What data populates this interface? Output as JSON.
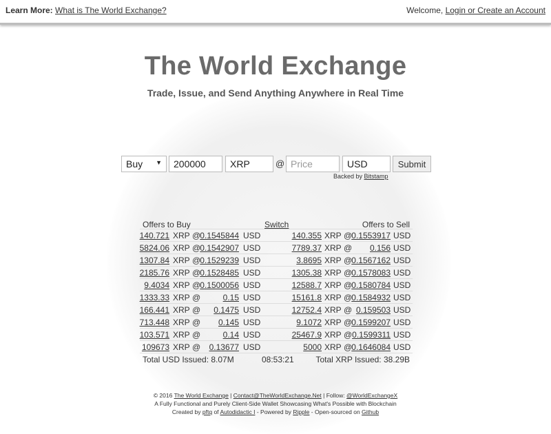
{
  "topbar": {
    "learn_label": "Learn More:",
    "learn_link": "What is The World Exchange?",
    "welcome": "Welcome,",
    "login_link": "Login or Create an Account"
  },
  "hero": {
    "title": "The World Exchange",
    "tagline": "Trade, Issue, and Send Anything Anywhere in Real Time"
  },
  "form": {
    "side": "Buy",
    "amount": "200000",
    "currency1": "XRP",
    "at": "@",
    "price_placeholder": "Price",
    "currency2": "USD",
    "submit": "Submit",
    "backed_by_label": "Backed by",
    "backed_by_link": "Bitstamp"
  },
  "book": {
    "buy_header": "Offers to Buy",
    "switch": "Switch",
    "sell_header": "Offers to Sell",
    "buy": [
      {
        "amount": "140.721",
        "cur": "XRP",
        "at": "@",
        "price": "0.1545844",
        "unit": "USD"
      },
      {
        "amount": "5824.06",
        "cur": "XRP",
        "at": "@",
        "price": "0.1542907",
        "unit": "USD"
      },
      {
        "amount": "1307.84",
        "cur": "XRP",
        "at": "@",
        "price": "0.1529239",
        "unit": "USD"
      },
      {
        "amount": "2185.76",
        "cur": "XRP",
        "at": "@",
        "price": "0.1528485",
        "unit": "USD"
      },
      {
        "amount": "9.4034",
        "cur": "XRP",
        "at": "@",
        "price": "0.1500056",
        "unit": "USD"
      },
      {
        "amount": "1333.33",
        "cur": "XRP",
        "at": "@",
        "price": "0.15",
        "unit": "USD"
      },
      {
        "amount": "166.441",
        "cur": "XRP",
        "at": "@",
        "price": "0.1475",
        "unit": "USD"
      },
      {
        "amount": "713.448",
        "cur": "XRP",
        "at": "@",
        "price": "0.145",
        "unit": "USD"
      },
      {
        "amount": "103.571",
        "cur": "XRP",
        "at": "@",
        "price": "0.14",
        "unit": "USD"
      },
      {
        "amount": "109673",
        "cur": "XRP",
        "at": "@",
        "price": "0.13677",
        "unit": "USD"
      }
    ],
    "sell": [
      {
        "amount": "140.355",
        "cur": "XRP",
        "at": "@",
        "price": "0.1553917",
        "unit": "USD"
      },
      {
        "amount": "7789.37",
        "cur": "XRP",
        "at": "@",
        "price": "0.156",
        "unit": "USD"
      },
      {
        "amount": "3.8695",
        "cur": "XRP",
        "at": "@",
        "price": "0.1567162",
        "unit": "USD"
      },
      {
        "amount": "1305.38",
        "cur": "XRP",
        "at": "@",
        "price": "0.1578083",
        "unit": "USD"
      },
      {
        "amount": "12588.7",
        "cur": "XRP",
        "at": "@",
        "price": "0.1580784",
        "unit": "USD"
      },
      {
        "amount": "15161.8",
        "cur": "XRP",
        "at": "@",
        "price": "0.1584932",
        "unit": "USD"
      },
      {
        "amount": "12752.4",
        "cur": "XRP",
        "at": "@",
        "price": "0.159503",
        "unit": "USD"
      },
      {
        "amount": "9.1072",
        "cur": "XRP",
        "at": "@",
        "price": "0.1599207",
        "unit": "USD"
      },
      {
        "amount": "25467.9",
        "cur": "XRP",
        "at": "@",
        "price": "0.1599311",
        "unit": "USD"
      },
      {
        "amount": "5000",
        "cur": "XRP",
        "at": "@",
        "price": "0.1646084",
        "unit": "USD"
      }
    ],
    "total_usd": "Total USD Issued: 8.07M",
    "time": "08:53:21",
    "total_xrp": "Total XRP Issued: 38.29B"
  },
  "footer": {
    "copyright": "© 2016",
    "site_link": "The World Exchange",
    "sep1": "|",
    "contact_link": "Contact@TheWorldExchange.Net",
    "sep2": "| Follow:",
    "twitter_link": "@WorldExchangeX",
    "line2": "A Fully Functional and Purely Client-Side Wallet Showcasing What's Possible with Blockchain",
    "created_by": "Created by",
    "author_link": "pftq",
    "of": "of",
    "company_link": "Autodidactic I",
    "powered": "- Powered by",
    "ripple_link": "Ripple",
    "opensourced": "- Open-sourced on",
    "github_link": "Github"
  },
  "icons": {
    "select_chevron": "chevron-down-icon"
  }
}
